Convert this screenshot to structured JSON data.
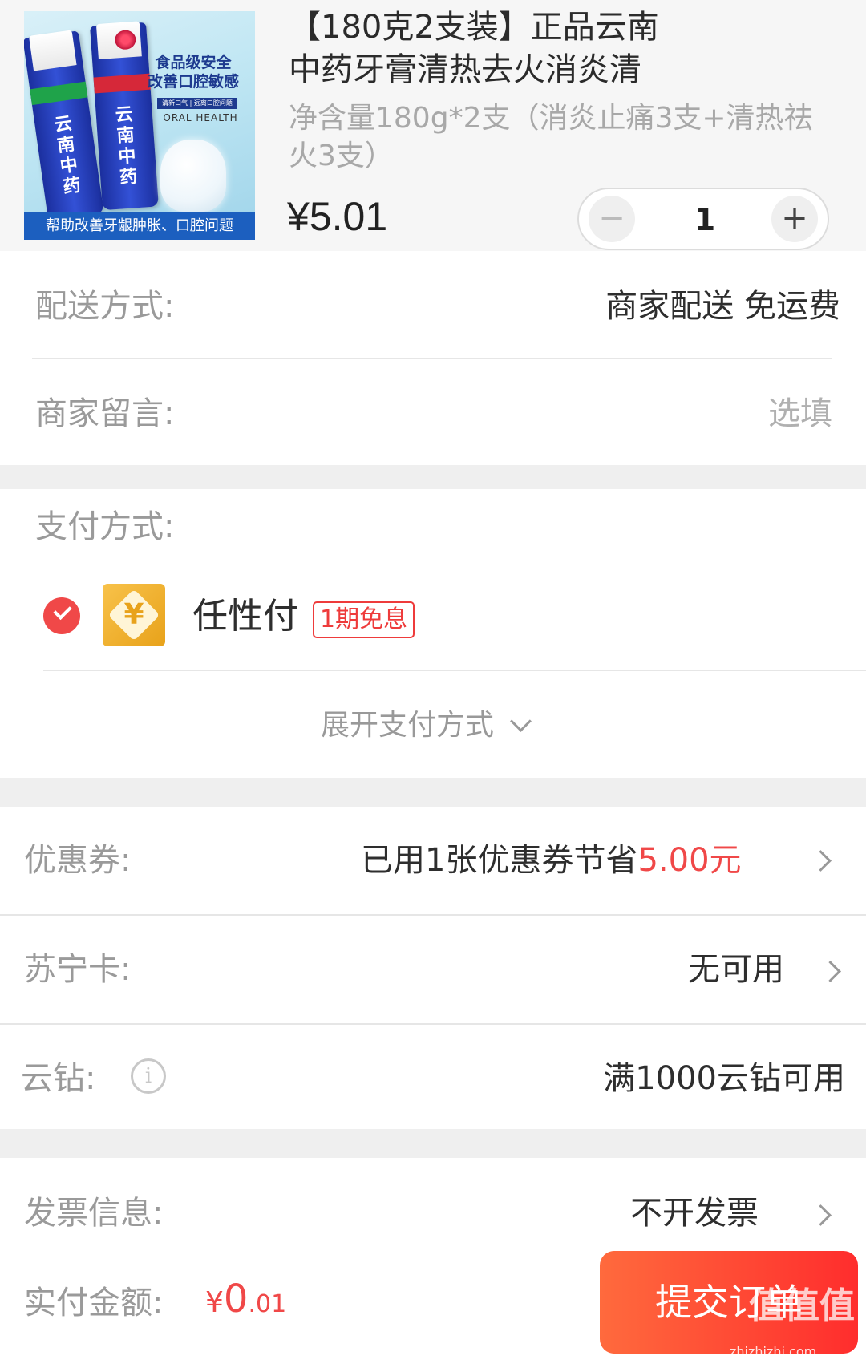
{
  "product": {
    "image_promo_line1": "食品级安全",
    "image_promo_line2": "改善口腔敏感",
    "image_tags": "清新口气 | 远离口腔问题",
    "image_english": "ORAL HEALTH",
    "image_tube_text": "云南中药",
    "image_bottom_text": "帮助改善牙龈肿胀、口腔问题",
    "title_line1": "【180克2支装】正品云南",
    "title_line2": "中药牙膏清热去火消炎清",
    "sku_line1": "净含量180g*2支（消炎止痛3支+清热祛",
    "sku_line2": "火3支）",
    "price": "¥5.01",
    "quantity": "1",
    "minus_symbol": "−",
    "plus_symbol": "+"
  },
  "delivery": {
    "label": "配送方式:",
    "value": "商家配送 免运费"
  },
  "message": {
    "label": "商家留言:",
    "placeholder": "选填"
  },
  "payment": {
    "label": "支付方式:",
    "method_name": "任性付",
    "method_badge": "1期免息",
    "method_icon_symbol": "¥",
    "expand_label": "展开支付方式"
  },
  "coupon": {
    "label": "优惠券:",
    "value_prefix": "已用1张优惠券节省",
    "value_amount": "5.00元"
  },
  "suning_card": {
    "label": "苏宁卡:",
    "value": "无可用"
  },
  "yunzuan": {
    "label": "云钻:",
    "info_symbol": "i",
    "value": "满1000云钻可用"
  },
  "invoice": {
    "label": "发票信息:",
    "value": "不开发票"
  },
  "footer": {
    "total_label": "实付金额:",
    "total_currency": "¥",
    "total_int": "0",
    "total_dec": ".01",
    "submit_label": "提交订单",
    "watermark_logo": "值值值",
    "watermark": "zhizhizhi.com"
  },
  "colors": {
    "accent_red": "#f04848",
    "submit_gradient_start": "#ff6a3d",
    "submit_gradient_end": "#ff2d2d",
    "badge_red": "#ee3b3b",
    "pay_icon_gold": "#e8a21a"
  },
  "icons": [
    "minus-icon",
    "plus-icon",
    "check-icon",
    "renxingfu-pay-icon",
    "chevron-down-icon",
    "chevron-right-icon",
    "info-icon"
  ]
}
